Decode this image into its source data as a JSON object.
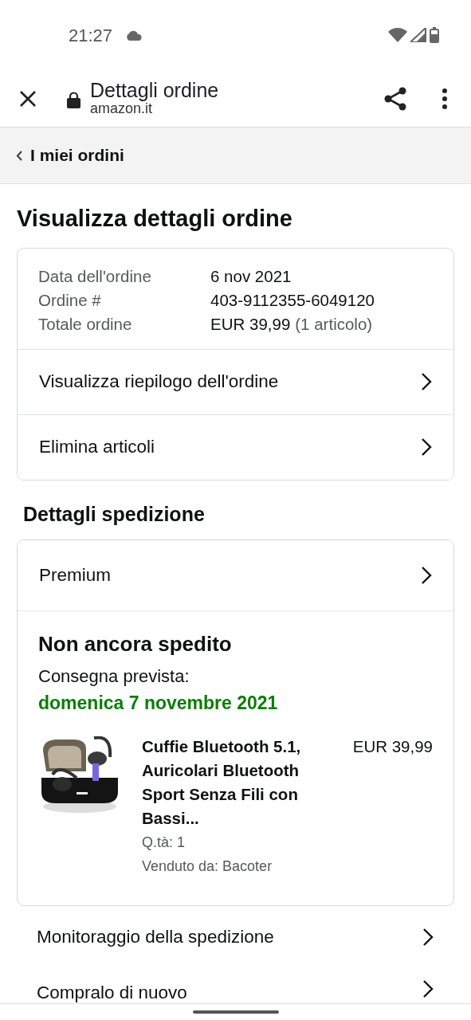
{
  "status_bar": {
    "time": "21:27"
  },
  "toolbar": {
    "title": "Dettagli ordine",
    "url": "amazon.it"
  },
  "breadcrumb": {
    "label": "I miei ordini"
  },
  "page_title": "Visualizza dettagli ordine",
  "order_summary": {
    "fields": [
      {
        "label": "Data dell'ordine",
        "value": "6 nov 2021"
      },
      {
        "label": "Ordine #",
        "value": "403-9112355-6049120"
      },
      {
        "label": "Totale ordine",
        "value": "EUR 39,99",
        "note": "(1 articolo)"
      }
    ],
    "links": [
      "Visualizza riepilogo dell'ordine",
      "Elimina articoli"
    ]
  },
  "shipping_title": "Dettagli spedizione",
  "shipment": {
    "service": "Premium",
    "status": "Non ancora spedito",
    "delivery_label": "Consegna prevista:",
    "delivery_date": "domenica 7 novembre 2021",
    "item": {
      "title": "Cuffie Bluetooth 5.1, Auricolari Bluetooth Sport Senza Fili con Bassi...",
      "price": "EUR 39,99",
      "quantity": "Q.tà: 1",
      "seller": "Venduto da: Bacoter"
    }
  },
  "actions": [
    "Monitoraggio della spedizione",
    "Compralo di nuovo"
  ]
}
